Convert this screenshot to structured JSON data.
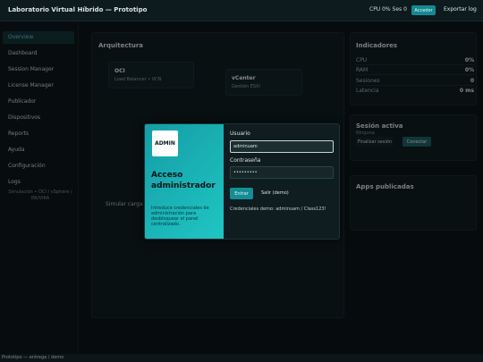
{
  "header": {
    "title": "Laboratorio Virtual Híbrido — Prototipo",
    "status": "CPU 0% Ses 0",
    "admin_button": "Acceder",
    "export_button": "Exportar log"
  },
  "sidebar": {
    "items": [
      {
        "label": "Overview",
        "active": true
      },
      {
        "label": "Dashboard"
      },
      {
        "label": "Session Manager"
      },
      {
        "label": "License Manager"
      },
      {
        "label": "Publicador"
      },
      {
        "label": "Dispositivos"
      },
      {
        "label": "Reports"
      },
      {
        "label": "Ayuda"
      },
      {
        "label": "Configuración"
      },
      {
        "label": "Logs"
      }
    ],
    "footer": "Simulación • OCI / vSphere / INUVIKA"
  },
  "architecture": {
    "title": "Arquitectura",
    "nodes": [
      {
        "title": "OCI",
        "subtitle": "Load Balancer • VCN"
      },
      {
        "title": "vCenter",
        "subtitle": "Gestión ESXi"
      }
    ],
    "simulate_label": "Simular carga"
  },
  "indicators": {
    "title": "Indicadores",
    "metrics": [
      {
        "label": "CPU",
        "value": "0%"
      },
      {
        "label": "RAM",
        "value": "0%"
      },
      {
        "label": "Sesiones",
        "value": "0"
      },
      {
        "label": "Latencia",
        "value": "0 ms"
      }
    ]
  },
  "session": {
    "title": "Sesión activa",
    "status": "Ninguna",
    "end_button": "Finalizar sesión",
    "connect_button": "Conectar"
  },
  "apps": {
    "title": "Apps publicadas"
  },
  "modal": {
    "logo": "ADMIN",
    "heading": "Acceso administrador",
    "description": "Introduce credenciales de administración para desbloquear el panel centralizado.",
    "user_label": "Usuario",
    "user_value": "adminuam",
    "password_label": "Contraseña",
    "password_value": "•••••••••",
    "enter_button": "Entrar",
    "exit_button": "Salir (demo)",
    "demo_credentials": "Credenciales demo: adminuam / Class123!"
  },
  "footer": "Prototipo — entrega / demo",
  "colors": {
    "accent": "#128a93",
    "modal_gradient_start": "#149da6",
    "modal_gradient_end": "#1fc6c4",
    "background": "#0c1517"
  }
}
